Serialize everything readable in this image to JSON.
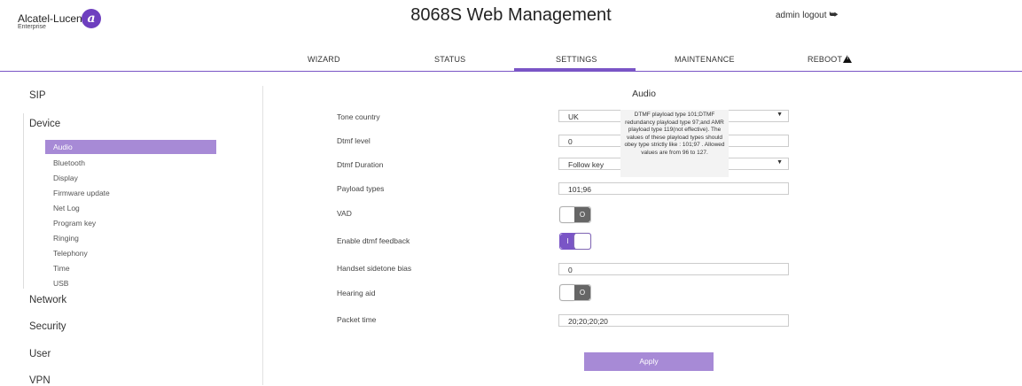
{
  "header": {
    "brand": "Alcatel-Lucent",
    "brand_sub": "Enterprise",
    "title": "8068S Web Management",
    "user": "admin",
    "logout": "logout",
    "brand_color": "#6e3fbf"
  },
  "nav": {
    "items": [
      {
        "label": "WIZARD"
      },
      {
        "label": "STATUS"
      },
      {
        "label": "SETTINGS"
      },
      {
        "label": "MAINTENANCE"
      },
      {
        "label": "REBOOT"
      }
    ],
    "active": "SETTINGS",
    "accent": "#7a55c6"
  },
  "sidebar": {
    "sections": [
      "SIP",
      "Device",
      "Network",
      "Security",
      "User",
      "VPN"
    ],
    "device_items": [
      "Audio",
      "Bluetooth",
      "Display",
      "Firmware update",
      "Net Log",
      "Program key",
      "Ringing",
      "Telephony",
      "Time",
      "USB"
    ],
    "active_item": "Audio"
  },
  "main": {
    "title": "Audio",
    "fields": {
      "tone_country": {
        "label": "Tone country",
        "value": "UK"
      },
      "dtmf_level": {
        "label": "Dtmf level",
        "value": "0"
      },
      "dtmf_duration": {
        "label": "Dtmf Duration",
        "value": "Follow key"
      },
      "payload_types": {
        "label": "Payload types",
        "value": "101;96"
      },
      "vad": {
        "label": "VAD",
        "state": "O"
      },
      "dtmf_feedback": {
        "label": "Enable dtmf feedback",
        "state": "I"
      },
      "sidetone": {
        "label": "Handset sidetone bias",
        "value": "0"
      },
      "hearing_aid": {
        "label": "Hearing aid",
        "state": "O"
      },
      "packet_time": {
        "label": "Packet time",
        "value": "20;20;20;20"
      }
    },
    "tooltip": "DTMF playload type 101;DTMF redundancy playload type 97;and AMR playload type 119(not effective). The values of these playload types should obey type strictly like : 101;97 . Allowed values are from 96 to 127.",
    "apply": "Apply"
  }
}
